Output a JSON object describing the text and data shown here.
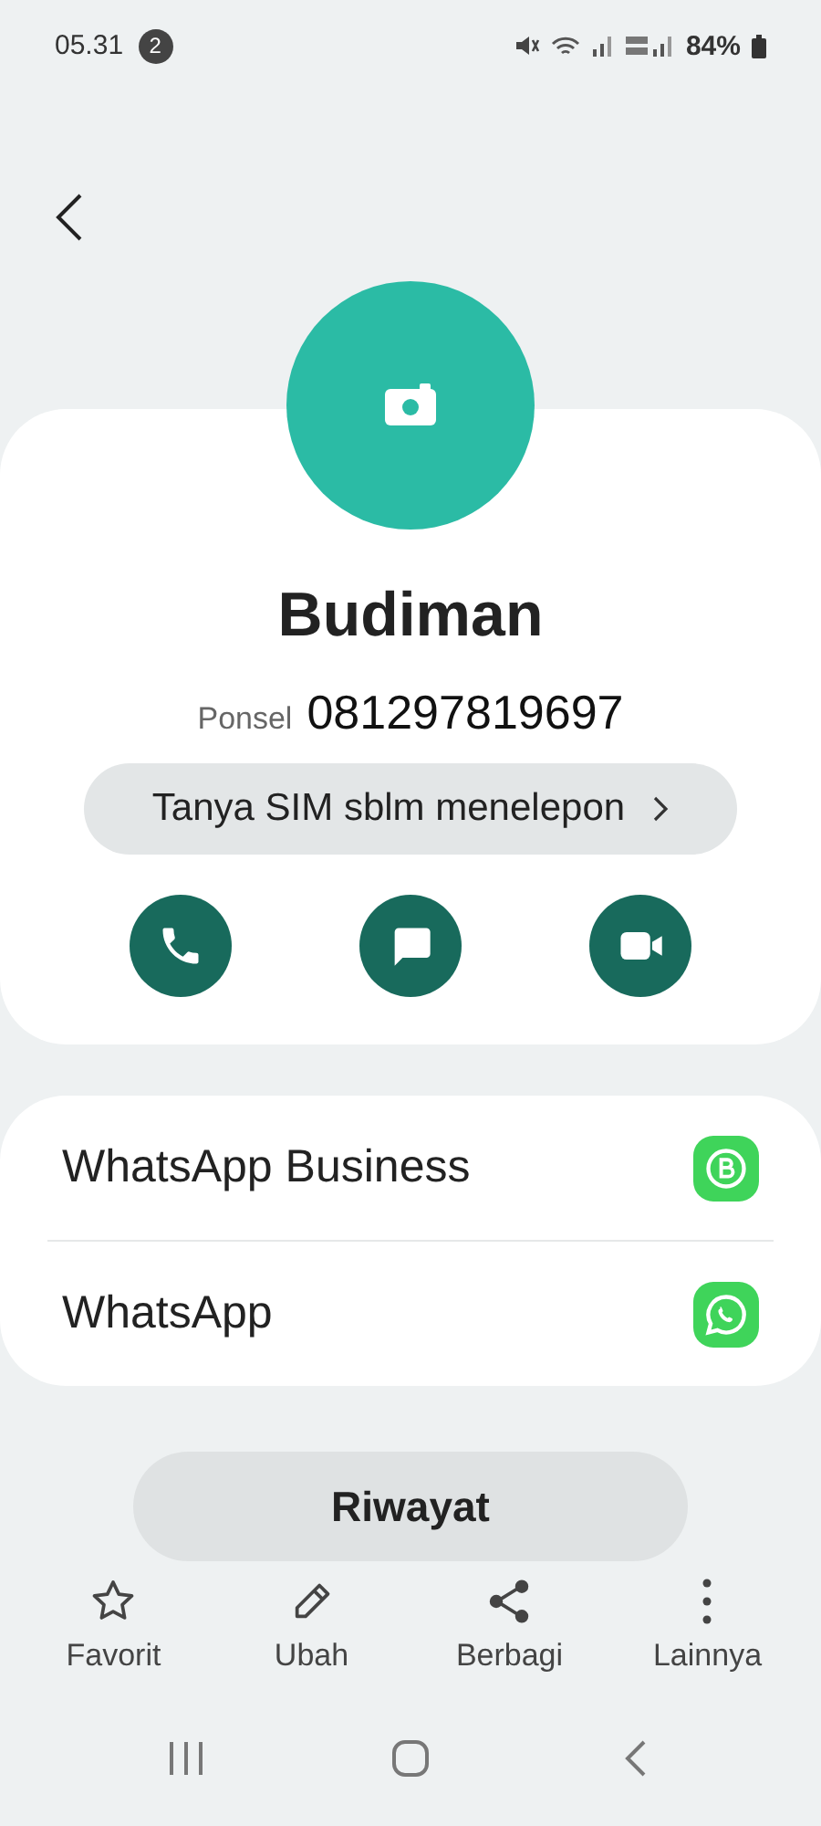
{
  "status_bar": {
    "time": "05.31",
    "notification_count": "2",
    "battery": "84%"
  },
  "contact": {
    "name": "Budiman",
    "phone_label": "Ponsel",
    "phone": "081297819697",
    "sim_button": "Tanya SIM sblm menelepon",
    "actions": [
      {
        "kind": "call"
      },
      {
        "kind": "message"
      },
      {
        "kind": "video"
      }
    ]
  },
  "apps": [
    {
      "name": "WhatsApp Business",
      "kind": "business"
    },
    {
      "name": "WhatsApp",
      "kind": "whatsapp"
    }
  ],
  "history_button": "Riwayat",
  "toolbar": [
    {
      "label": "Favorit",
      "kind": "star"
    },
    {
      "label": "Ubah",
      "kind": "edit"
    },
    {
      "label": "Berbagi",
      "kind": "share"
    },
    {
      "label": "Lainnya",
      "kind": "more"
    }
  ]
}
